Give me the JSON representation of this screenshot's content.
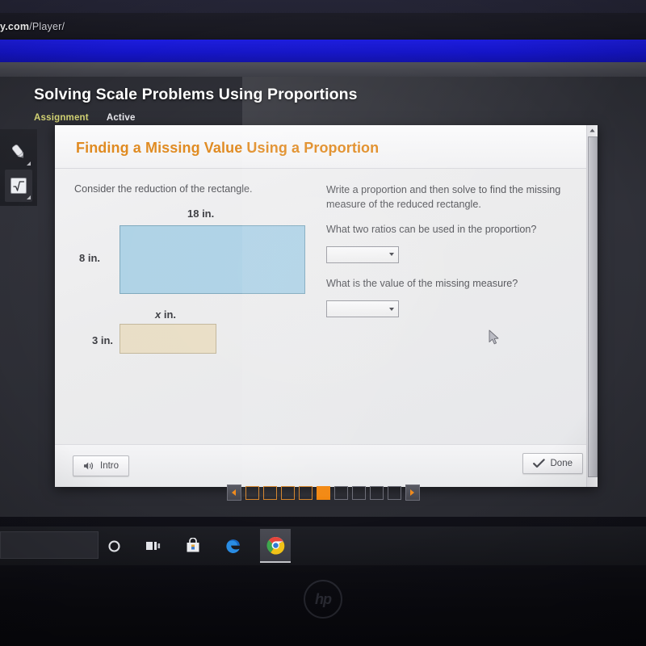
{
  "browser": {
    "url_fragment_bold": "y.com",
    "url_fragment_rest": "/Player/"
  },
  "lesson": {
    "title": "Solving Scale Problems Using Proportions",
    "status_type": "Assignment",
    "status_state": "Active"
  },
  "tools": [
    {
      "name": "pen-tool",
      "icon": "pencil-icon"
    },
    {
      "name": "calculator-tool",
      "icon": "square-root-icon"
    }
  ],
  "card": {
    "heading": "Finding a Missing Value Using a Proportion",
    "heading_color": "#e08a20",
    "left": {
      "prompt": "Consider the reduction of the rectangle.",
      "figure_large": {
        "top_label": "18 in.",
        "side_label": "8 in.",
        "fill_color": "#aed2e6"
      },
      "figure_small": {
        "top_label_value": "x",
        "top_label_unit": " in.",
        "side_label": "3 in.",
        "fill_color": "#e9dec6"
      }
    },
    "right": {
      "instruction": "Write a proportion and then solve to find the missing measure of the reduced rectangle.",
      "question_1": "What two ratios can be used in the proportion?",
      "dropdown_1_value": "",
      "question_2": "What is the value of the missing measure?",
      "dropdown_2_value": ""
    },
    "footer": {
      "intro_label": "Intro",
      "intro_icon": "speaker-icon",
      "done_label": "Done",
      "done_icon": "checkmark-icon"
    }
  },
  "pager": {
    "prev_icon": "chevron-left-icon",
    "next_icon": "chevron-right-icon",
    "total_steps": 9,
    "current_step": 5,
    "accent_color": "#f3870f",
    "steps": [
      {
        "state": "done"
      },
      {
        "state": "done"
      },
      {
        "state": "done"
      },
      {
        "state": "done"
      },
      {
        "state": "current"
      },
      {
        "state": "todo"
      },
      {
        "state": "todo"
      },
      {
        "state": "todo"
      },
      {
        "state": "todo"
      }
    ]
  },
  "taskbar": {
    "items": [
      {
        "name": "cortana-icon",
        "glyph": "search-circle"
      },
      {
        "name": "task-view-icon",
        "glyph": "task-view"
      },
      {
        "name": "microsoft-store-icon",
        "glyph": "store"
      },
      {
        "name": "edge-browser-icon",
        "glyph": "edge"
      },
      {
        "name": "chrome-browser-icon",
        "glyph": "chrome",
        "active": true
      }
    ]
  },
  "device": {
    "brand_logo": "hp"
  }
}
